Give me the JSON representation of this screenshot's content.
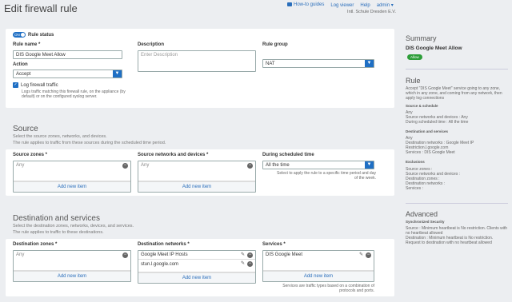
{
  "page": {
    "title": "Edit firewall rule"
  },
  "topnav": {
    "howto": "How-to guides",
    "logviewer": "Log viewer",
    "help": "Help",
    "admin": "admin ▾",
    "org": "Intl. Schule Dresden E.V."
  },
  "rule": {
    "status_on": "ON",
    "status_label": "Rule status",
    "name_label": "Rule name *",
    "name_value": "DIS Google Meet Allow",
    "action_label": "Action",
    "action_value": "Accept",
    "log_label": "Log firewall traffic",
    "log_hint": "Logs traffic matching this firewall rule, on the appliance (by default) or on the configured syslog server.",
    "desc_label": "Description",
    "desc_placeholder": "Enter Description",
    "group_label": "Rule group",
    "group_value": "NAT"
  },
  "source": {
    "heading": "Source",
    "desc1": "Select the source zones, networks, and devices.",
    "desc2": "The rule applies to traffic from these sources during the scheduled time period.",
    "zones_label": "Source zones *",
    "zones_any": "Any",
    "zones_add": "Add new item",
    "nets_label": "Source networks and devices *",
    "nets_any": "Any",
    "nets_add": "Add new item",
    "sched_label": "During scheduled time",
    "sched_value": "All the time",
    "sched_hint": "Select to apply the rule to a specific time period and day of the week."
  },
  "dest": {
    "heading": "Destination and services",
    "desc1": "Select the destination zones, networks, devices, and services.",
    "desc2": "The rule applies to traffic to these destinations.",
    "zones_label": "Destination zones *",
    "zones_any": "Any",
    "zones_add": "Add new item",
    "nets_label": "Destination networks *",
    "nets_items": [
      "Google Meet IP Hosts",
      "stun.l.google.com"
    ],
    "nets_add": "Add new item",
    "svc_label": "Services *",
    "svc_item": "DIS Google Meet",
    "svc_add": "Add new item",
    "svc_hint": "Services are traffic types based on a combination of protocols and ports."
  },
  "summary": {
    "heading": "Summary",
    "name": "DIS Google Meet Allow",
    "badge": "Allow",
    "rule_heading": "Rule",
    "rule_text": "Accept \"DIS Google Meet\" service going to any zone, which in any zone, and coming from any network, then apply log connections",
    "src_sched_h": "Source & schedule",
    "src_lines": [
      "Any",
      "Source networks and devices : Any",
      "During scheduled time : All the time"
    ],
    "dst_h": "Destination and services",
    "dst_lines": [
      "Any",
      "Destination networks : Google Meet IP",
      "Restriction.l.google.com",
      "Services : DIS Google Meet"
    ],
    "excl_h": "Exclusions",
    "excl_lines": [
      "Source zones :",
      "Source networks and devices :",
      "Destination zones :",
      "Destination networks :",
      "Services :"
    ],
    "adv_heading": "Advanced",
    "sync_h": "Synchronized Security",
    "sync_lines": [
      "Source : Minimum heartbeat is No restriction. Clients with no heartbeat allowed",
      "Destination : Minimum heartbeat is No restriction. Request to destination with no heartbeat allowed"
    ]
  },
  "colors": {
    "accent": "#1f6fc4",
    "allow": "#2e9e3a",
    "toggle": "#1f6fc4"
  }
}
